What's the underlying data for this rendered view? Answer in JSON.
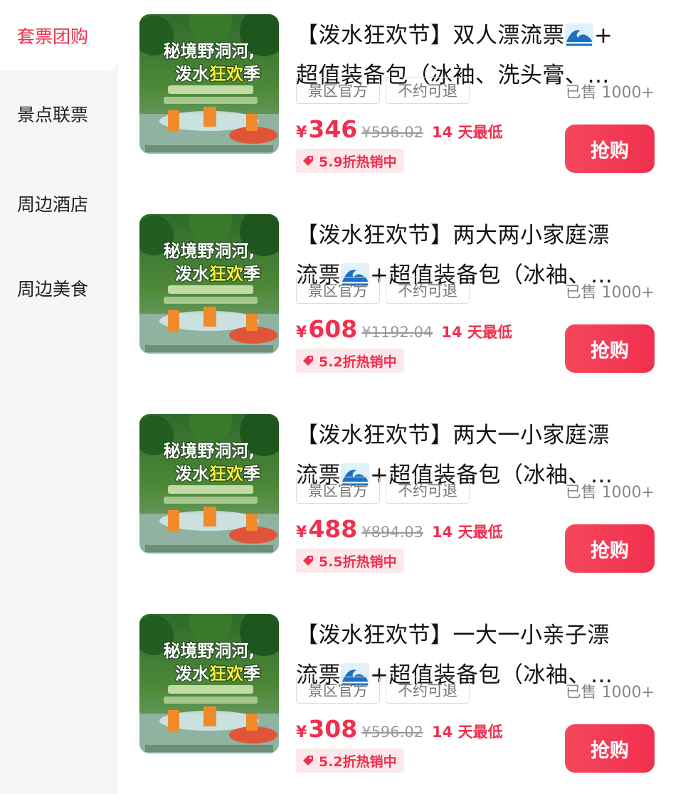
{
  "colors": {
    "accent": "#f0304e",
    "sidebar_bg": "#f6f6f7",
    "hot_bg": "#fde9ec"
  },
  "sidebar": {
    "items": [
      {
        "label": "套票团购",
        "active": true
      },
      {
        "label": "景点联票",
        "active": false
      },
      {
        "label": "周边酒店",
        "active": false
      },
      {
        "label": "周边美食",
        "active": false
      }
    ]
  },
  "thumbnail_text": {
    "line1": "秘境野洞河,",
    "line2a": "泼水",
    "line2b": "狂欢",
    "line2c": "季"
  },
  "products": [
    {
      "title_line1": "【泼水狂欢节】双人漂流票",
      "title_line1_tail": "+",
      "title_line2_head": "",
      "title_line2": "超值装备包（冰袖、洗头膏、…",
      "tag1": "景区官方",
      "tag2": "不约可退",
      "sold": "已售 1000+",
      "currency": "¥",
      "price": "346",
      "original_price": "¥596.02",
      "lowest_label": "14 天最低",
      "discount": "5.9折热销中",
      "buy_label": "抢购",
      "wave_in_line": 1
    },
    {
      "title_line1": "【泼水狂欢节】两大两小家庭漂",
      "title_line1_tail": "",
      "title_line2_head": "流票",
      "title_line2": "+超值装备包（冰袖、…",
      "tag1": "景区官方",
      "tag2": "不约可退",
      "sold": "已售 1000+",
      "currency": "¥",
      "price": "608",
      "original_price": "¥1192.04",
      "lowest_label": "14 天最低",
      "discount": "5.2折热销中",
      "buy_label": "抢购",
      "wave_in_line": 2
    },
    {
      "title_line1": "【泼水狂欢节】两大一小家庭漂",
      "title_line1_tail": "",
      "title_line2_head": "流票",
      "title_line2": "+超值装备包（冰袖、…",
      "tag1": "景区官方",
      "tag2": "不约可退",
      "sold": "已售 1000+",
      "currency": "¥",
      "price": "488",
      "original_price": "¥894.03",
      "lowest_label": "14 天最低",
      "discount": "5.5折热销中",
      "buy_label": "抢购",
      "wave_in_line": 2
    },
    {
      "title_line1": "【泼水狂欢节】一大一小亲子漂",
      "title_line1_tail": "",
      "title_line2_head": "流票",
      "title_line2": "+超值装备包（冰袖、…",
      "tag1": "景区官方",
      "tag2": "不约可退",
      "sold": "已售 1000+",
      "currency": "¥",
      "price": "308",
      "original_price": "¥596.02",
      "lowest_label": "14 天最低",
      "discount": "5.2折热销中",
      "buy_label": "抢购",
      "wave_in_line": 2
    }
  ]
}
